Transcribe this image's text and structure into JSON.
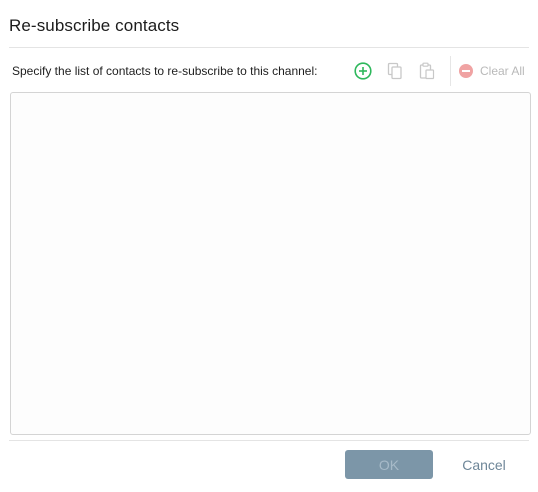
{
  "dialog": {
    "title": "Re-subscribe contacts",
    "instruction": "Specify the list of contacts to re-subscribe to this channel:"
  },
  "toolbar": {
    "add_icon": "add-circle-icon",
    "copy_icon": "copy-icon",
    "paste_icon": "paste-icon",
    "clear_all_label": "Clear All",
    "clear_all_icon": "remove-circle-icon"
  },
  "contacts_list": {
    "items": []
  },
  "footer": {
    "ok_label": "OK",
    "cancel_label": "Cancel"
  },
  "colors": {
    "add_icon": "#2eb85c",
    "disabled_icon": "#c8c8c8",
    "clear_all_icon": "#f0a3a3",
    "ok_button_bg": "#7c96a8",
    "cancel_text": "#6e8698"
  }
}
